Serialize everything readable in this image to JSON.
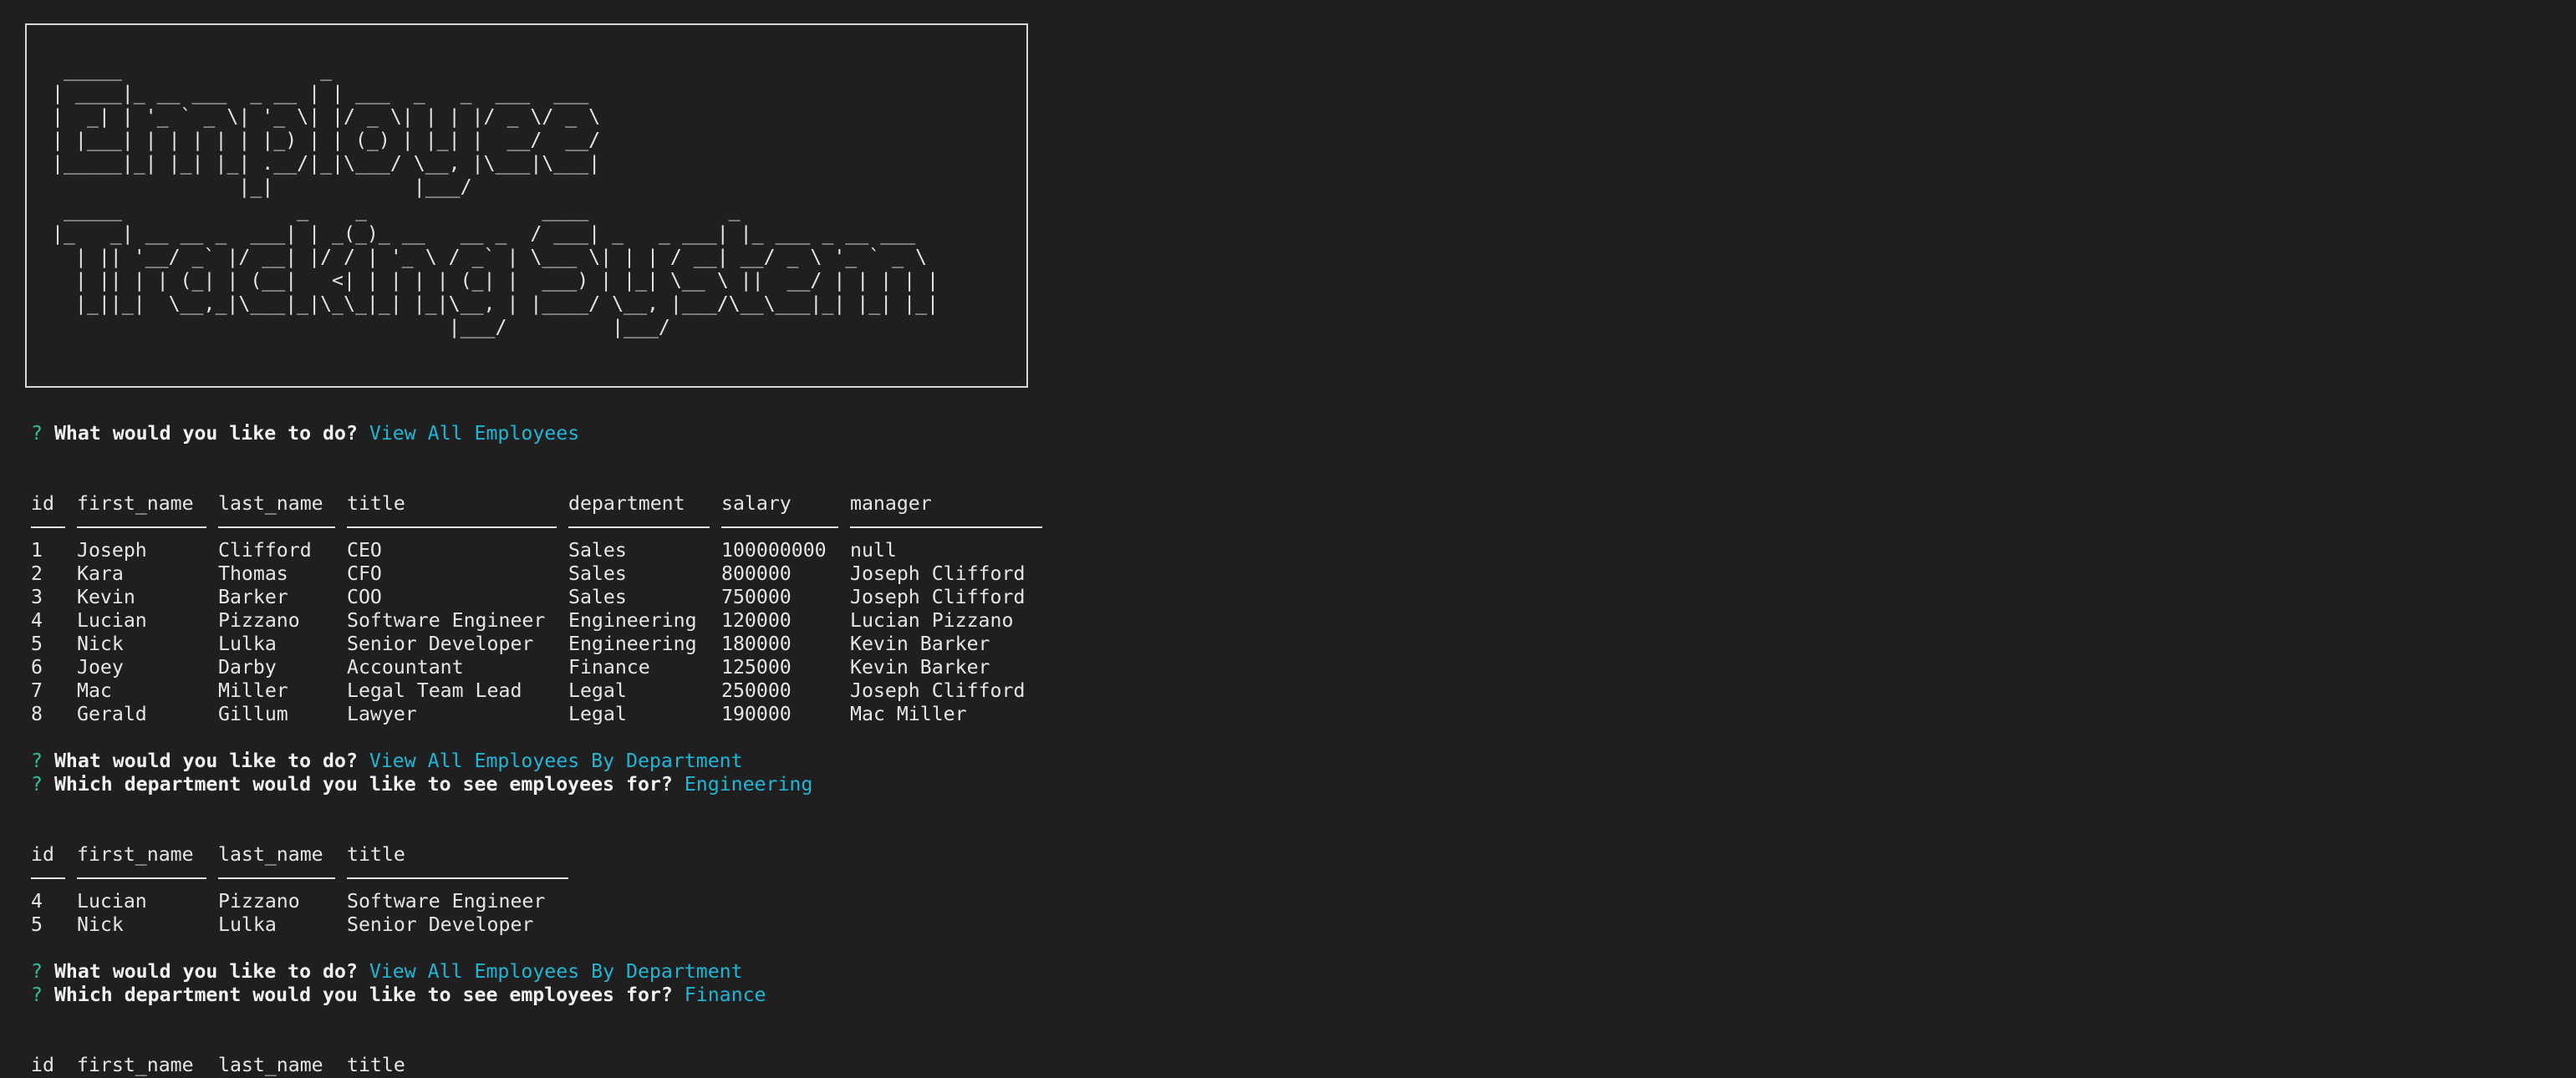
{
  "banner": {
    "art": [
      " _____                 _",
      "| ____|_ __ ___  _ __ | | ___  _   _  ___  ___",
      "|  _| | '_ ` _ \\| '_ \\| |/ _ \\| | | |/ _ \\/ _ \\",
      "| |___| | | | | | |_) | | (_) | |_| |  __/  __/",
      "|_____|_| |_| |_| .__/|_|\\___/ \\__, |\\___|\\___|",
      "                |_|            |___/",
      " _____               _    _               ____            _",
      "|_   _| __ __ _  ___| | _(_)_ __   __ _  / ___| _   _ ___| |_ ___ _ __ ___",
      "  | || '__/ _` |/ __| |/ / | '_ \\ / _` | \\___ \\| | | / __| __/ _ \\ '_ ` _ \\",
      "  | || | | (_| | (__|   <| | | | | (_| |  ___) | |_| \\__ \\ ||  __/ | | | | |",
      "  |_||_|  \\__,_|\\___|_|\\_\\_|_| |_|\\__, | |____/ \\__, |___/\\__\\___|_| |_| |_|",
      "                                  |___/         |___/"
    ]
  },
  "prompts": [
    {
      "mark": "?",
      "question": "What would you like to do?",
      "answer": "View All Employees"
    },
    {
      "mark": "?",
      "question": "What would you like to do?",
      "answer": "View All Employees By Department"
    },
    {
      "mark": "?",
      "question": "Which department would you like to see employees for?",
      "answer": "Engineering"
    },
    {
      "mark": "?",
      "question": "What would you like to do?",
      "answer": "View All Employees By Department"
    },
    {
      "mark": "?",
      "question": "Which department would you like to see employees for?",
      "answer": "Finance"
    }
  ],
  "table_all": {
    "columns": [
      "id",
      "first_name",
      "last_name",
      "title",
      "department",
      "salary",
      "manager"
    ],
    "rows": [
      [
        "1",
        "Joseph",
        "Clifford",
        "CEO",
        "Sales",
        "100000000",
        "null"
      ],
      [
        "2",
        "Kara",
        "Thomas",
        "CFO",
        "Sales",
        "800000",
        "Joseph Clifford"
      ],
      [
        "3",
        "Kevin",
        "Barker",
        "COO",
        "Sales",
        "750000",
        "Joseph Clifford"
      ],
      [
        "4",
        "Lucian",
        "Pizzano",
        "Software Engineer",
        "Engineering",
        "120000",
        "Lucian Pizzano"
      ],
      [
        "5",
        "Nick",
        "Lulka",
        "Senior Developer",
        "Engineering",
        "180000",
        "Kevin Barker"
      ],
      [
        "6",
        "Joey",
        "Darby",
        "Accountant",
        "Finance",
        "125000",
        "Kevin Barker"
      ],
      [
        "7",
        "Mac",
        "Miller",
        "Legal Team Lead",
        "Legal",
        "250000",
        "Joseph Clifford"
      ],
      [
        "8",
        "Gerald",
        "Gillum",
        "Lawyer",
        "Legal",
        "190000",
        "Mac Miller"
      ]
    ]
  },
  "table_engineering": {
    "columns": [
      "id",
      "first_name",
      "last_name",
      "title"
    ],
    "rows": [
      [
        "4",
        "Lucian",
        "Pizzano",
        "Software Engineer"
      ],
      [
        "5",
        "Nick",
        "Lulka",
        "Senior Developer"
      ]
    ]
  },
  "table_finance": {
    "columns": [
      "id",
      "first_name",
      "last_name",
      "title"
    ]
  }
}
